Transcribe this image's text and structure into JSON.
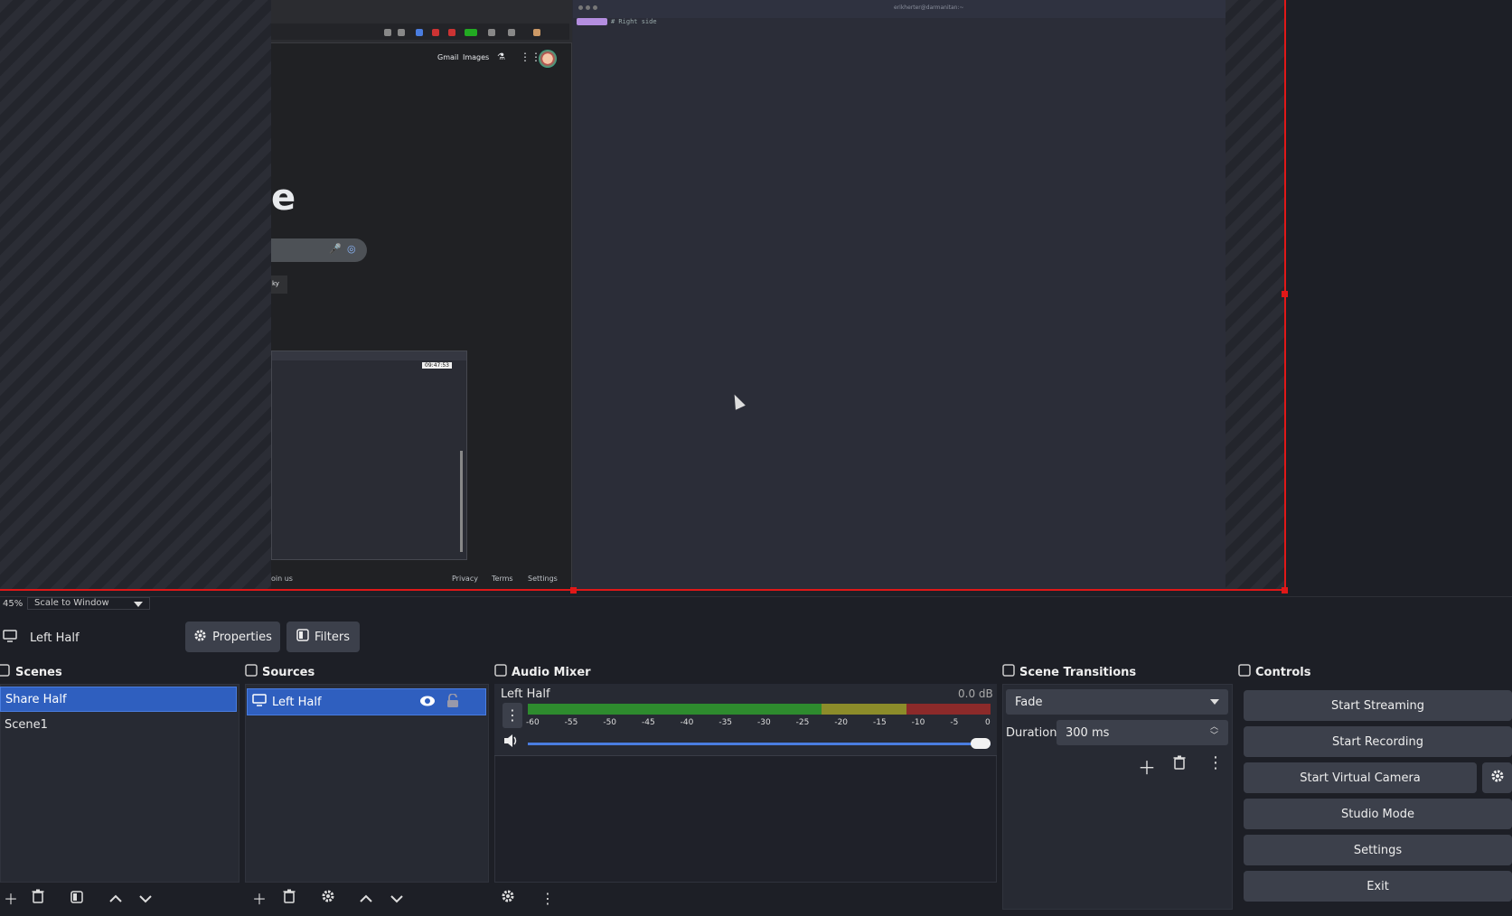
{
  "preview": {
    "browser": {
      "gmail_link": "Gmail",
      "images_link": "Images",
      "logo_fragment": "e",
      "lucky_fragment": "ky",
      "clock": "09:47:53",
      "footer_left": "oin us",
      "footer_privacy": "Privacy",
      "footer_terms": "Terms",
      "footer_settings": "Settings"
    },
    "terminal": {
      "title": "erikherter@darmanitan:~",
      "prompt": "# Right side"
    }
  },
  "status": {
    "zoom": "45%",
    "scale_mode": "Scale to Window"
  },
  "source_toolbar": {
    "selected_source": "Left Half",
    "properties_label": "Properties",
    "filters_label": "Filters"
  },
  "scenes": {
    "title": "Scenes",
    "items": [
      {
        "label": "Share Half",
        "selected": true
      },
      {
        "label": "Scene1",
        "selected": false
      }
    ]
  },
  "sources": {
    "title": "Sources",
    "items": [
      {
        "label": "Left Half",
        "selected": true
      }
    ]
  },
  "audio_mixer": {
    "title": "Audio Mixer",
    "channel_name": "Left Half",
    "level": "0.0 dB",
    "ticks": [
      "-60",
      "-55",
      "-50",
      "-45",
      "-40",
      "-35",
      "-30",
      "-25",
      "-20",
      "-15",
      "-10",
      "-5",
      "0"
    ],
    "volume_fraction": 1.0
  },
  "transitions": {
    "title": "Scene Transitions",
    "selected": "Fade",
    "duration_label": "Duration",
    "duration_value": "300 ms"
  },
  "controls": {
    "title": "Controls",
    "start_streaming": "Start Streaming",
    "start_recording": "Start Recording",
    "start_virtual_camera": "Start Virtual Camera",
    "studio_mode": "Studio Mode",
    "settings": "Settings",
    "exit": "Exit"
  },
  "colors": {
    "accent": "#2f5fbf",
    "selection_red": "#e01818",
    "meter_green": "#2e8b2e",
    "meter_yellow": "#8c8c2a",
    "meter_red": "#8c2a2a"
  }
}
